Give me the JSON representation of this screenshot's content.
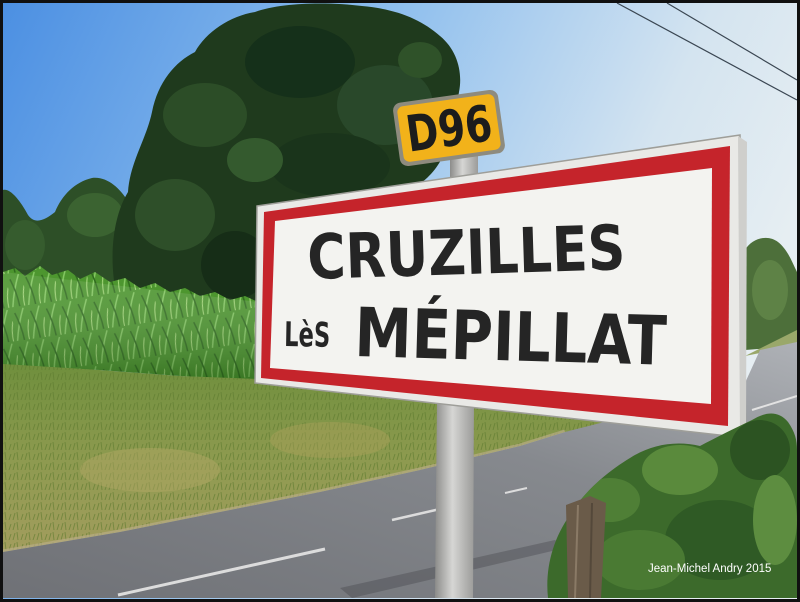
{
  "photo": {
    "route_plate": {
      "label": "D96"
    },
    "town_sign": {
      "line1": "CRUZILLES",
      "line2_prefix": "LèS",
      "line2_main": "MÉPILLAT"
    },
    "watermark": "Jean-Michel Andry 2015"
  },
  "colors": {
    "sign_border": "#c5242b",
    "sign_face": "#f3f3f0",
    "sign_text": "#252525",
    "plate_yellow": "#f2b21a",
    "plate_text": "#1c1c1c",
    "foliage_dark": "#1f3a1d",
    "bush_green": "#3c6a2b",
    "wooden_post": "#6a5b49",
    "watermark_text": "#ffffff"
  }
}
